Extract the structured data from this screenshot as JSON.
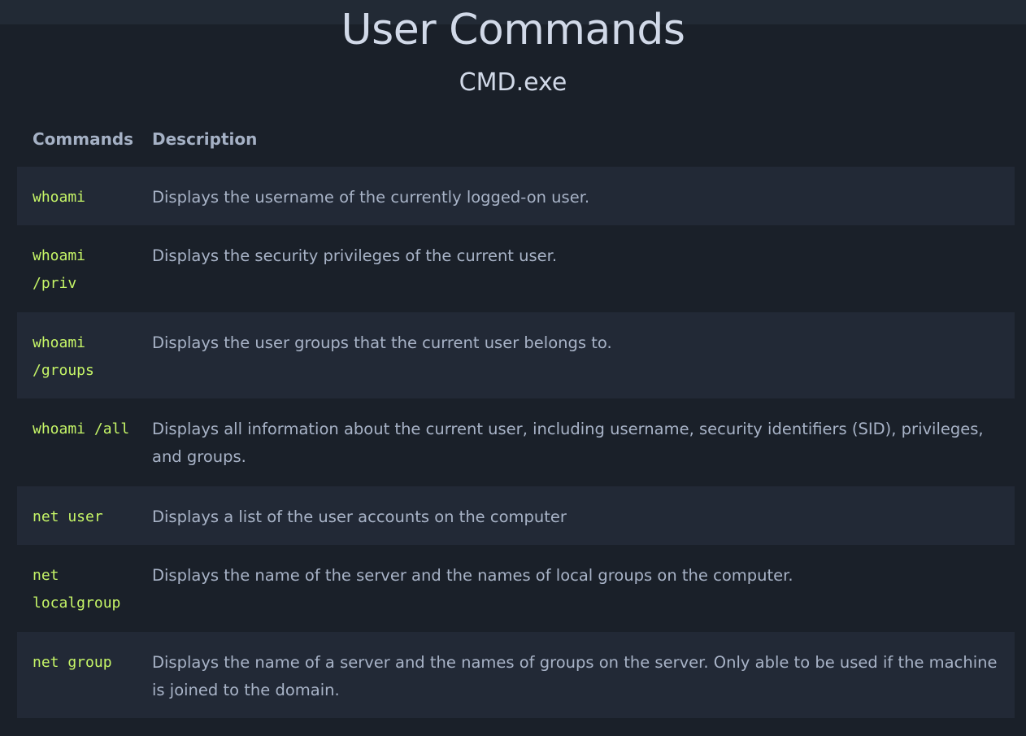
{
  "page": {
    "title": "User Commands",
    "subtitle": "CMD.exe"
  },
  "table": {
    "headers": {
      "command": "Commands",
      "description": "Description"
    },
    "rows": [
      {
        "command": "whoami",
        "description": "Displays the username of the currently logged-on user."
      },
      {
        "command": "whoami\n/priv",
        "description": "Displays the security privileges of the current user."
      },
      {
        "command": "whoami\n/groups",
        "description": "Displays the user groups that the current user belongs to."
      },
      {
        "command": "whoami /all",
        "description": "Displays all information about the current user, including username, security identifiers (SID), privileges, and groups."
      },
      {
        "command": "net user",
        "description": "Displays a list of the user accounts on the computer"
      },
      {
        "command": "net\nlocalgroup",
        "description": "Displays the name of the server and the names of local groups on the computer."
      },
      {
        "command": "net group",
        "description": "Displays the name of a server and the names of groups on the server. Only able to be used if the machine is joined to the domain."
      }
    ]
  },
  "colors": {
    "background": "#1a2029",
    "row_alt": "#222936",
    "command_text": "#c5f467",
    "body_text": "#a8b3c7",
    "title_text": "#d1d9e8"
  }
}
